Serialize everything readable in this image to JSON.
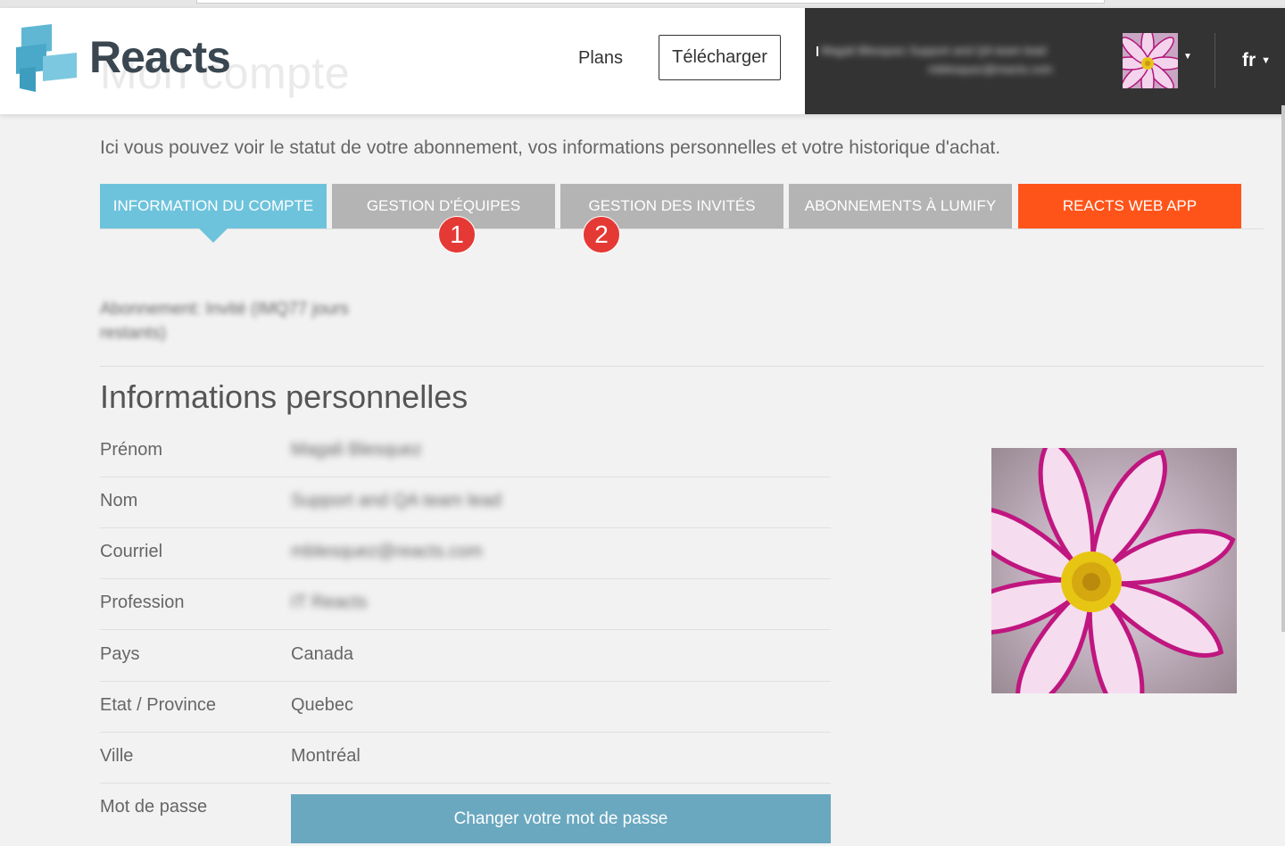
{
  "header": {
    "logo_text": "Reacts",
    "ghost_title": "Mon compte",
    "nav_plans": "Plans",
    "nav_download": "Télécharger",
    "user_name_line": "Magali Blesquez Support and QA team lead",
    "user_email_line": "mblesquez@reacts.com",
    "language": "fr"
  },
  "intro": "Ici vous pouvez voir le statut de votre abonnement, vos informations personnelles et votre historique d'achat.",
  "tabs": [
    {
      "label": "Information du compte"
    },
    {
      "label": "Gestion d'équipes"
    },
    {
      "label": "Gestion des invités"
    },
    {
      "label": "Abonnements à Lumify"
    },
    {
      "label": "Reacts Web App"
    }
  ],
  "badges": [
    "1",
    "2"
  ],
  "subscription_text": "Abonnement: Invité (IMQ77 jours restants)",
  "personal": {
    "title": "Informations personnelles",
    "rows": [
      {
        "label": "Prénom",
        "value": "Magali Blesquez"
      },
      {
        "label": "Nom",
        "value": "Support and QA team lead"
      },
      {
        "label": "Courriel",
        "value": "mblesquez@reacts.com"
      },
      {
        "label": "Profession",
        "value": "IT Reacts"
      },
      {
        "label": "Pays",
        "value": "Canada"
      },
      {
        "label": "Etat / Province",
        "value": "Quebec"
      },
      {
        "label": "Ville",
        "value": "Montréal"
      },
      {
        "label": "Mot de passe",
        "value": ""
      }
    ],
    "change_password_label": "Changer votre mot de passe"
  },
  "colors": {
    "tab_active": "#6ec3dc",
    "tab_inactive": "#b4b4b4",
    "tab_webapp": "#ff5419",
    "badge": "#e53935",
    "password_button": "#6aa8c0"
  }
}
